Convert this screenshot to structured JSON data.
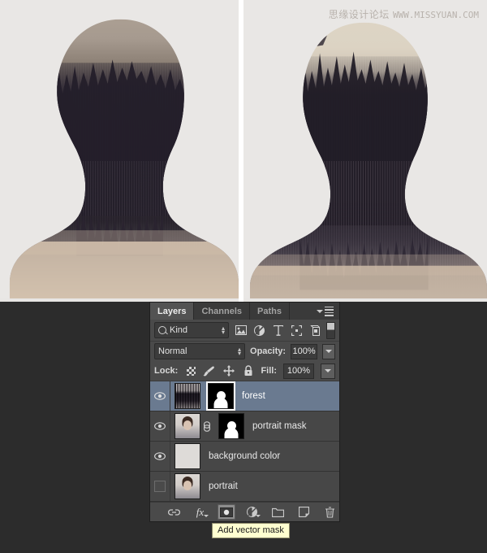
{
  "watermark": {
    "cn": "思缘设计论坛",
    "en": "WWW.MISSYUAN.COM"
  },
  "canvas": {
    "left_image_alt": "double-exposure portrait silhouette filled with dark pine forest",
    "right_image_alt": "double-exposure portrait silhouette with forest and pale sky"
  },
  "panel": {
    "tabs": [
      {
        "label": "Layers",
        "active": true
      },
      {
        "label": "Channels",
        "active": false
      },
      {
        "label": "Paths",
        "active": false
      }
    ],
    "menu_icon": "panel-menu-icon",
    "filter": {
      "kind_label": "Kind",
      "search_icon": "magnifier-icon",
      "icons": [
        "filter-pixel-layers-icon",
        "filter-adjustment-layers-icon",
        "filter-type-layers-icon",
        "filter-shape-layers-icon",
        "filter-smart-object-icon"
      ],
      "toggle_icon": "filter-toggle-switch"
    },
    "blend": {
      "mode": "Normal",
      "opacity_label": "Opacity:",
      "opacity_value": "100%"
    },
    "lock": {
      "label": "Lock:",
      "icons": [
        "lock-transparent-pixels-icon",
        "lock-image-pixels-icon",
        "lock-position-icon",
        "lock-all-icon"
      ],
      "fill_label": "Fill:",
      "fill_value": "100%"
    },
    "layers": [
      {
        "name": "forest",
        "visible": true,
        "selected": true,
        "thumb": "forest-thumbnail",
        "mask": "vector-mask-thumbnail",
        "mask_active": true,
        "linked": false
      },
      {
        "name": "portrait mask",
        "visible": true,
        "selected": false,
        "thumb": "portrait-thumbnail",
        "mask": "layer-mask-thumbnail",
        "mask_active": false,
        "linked": true
      },
      {
        "name": "background color",
        "visible": true,
        "selected": false,
        "thumb": "solid-color-thumbnail",
        "mask": null,
        "mask_active": false,
        "linked": false
      },
      {
        "name": "portrait",
        "visible": false,
        "selected": false,
        "thumb": "portrait-thumbnail",
        "mask": null,
        "mask_active": false,
        "linked": false
      }
    ],
    "bottom_buttons": [
      {
        "name": "link-layers-button",
        "icon": "link-icon",
        "pressed": false
      },
      {
        "name": "layer-style-button",
        "icon": "fx-icon",
        "pressed": false
      },
      {
        "name": "add-layer-mask-button",
        "icon": "mask-icon",
        "pressed": true
      },
      {
        "name": "new-adjustment-layer-button",
        "icon": "half-circle-icon",
        "pressed": false
      },
      {
        "name": "new-group-button",
        "icon": "folder-icon",
        "pressed": false
      },
      {
        "name": "new-layer-button",
        "icon": "new-layer-icon",
        "pressed": false
      },
      {
        "name": "delete-layer-button",
        "icon": "trash-icon",
        "pressed": false
      }
    ]
  },
  "tooltip": {
    "text": "Add vector mask"
  },
  "colors": {
    "panel_bg": "#4a4a4a",
    "panel_row": "#474747",
    "selected_row": "#6a7a90",
    "tab_active": "#535353",
    "text": "#e8e8e8",
    "tooltip_bg": "#ffffd0",
    "app_bg": "#2c2c2c"
  }
}
